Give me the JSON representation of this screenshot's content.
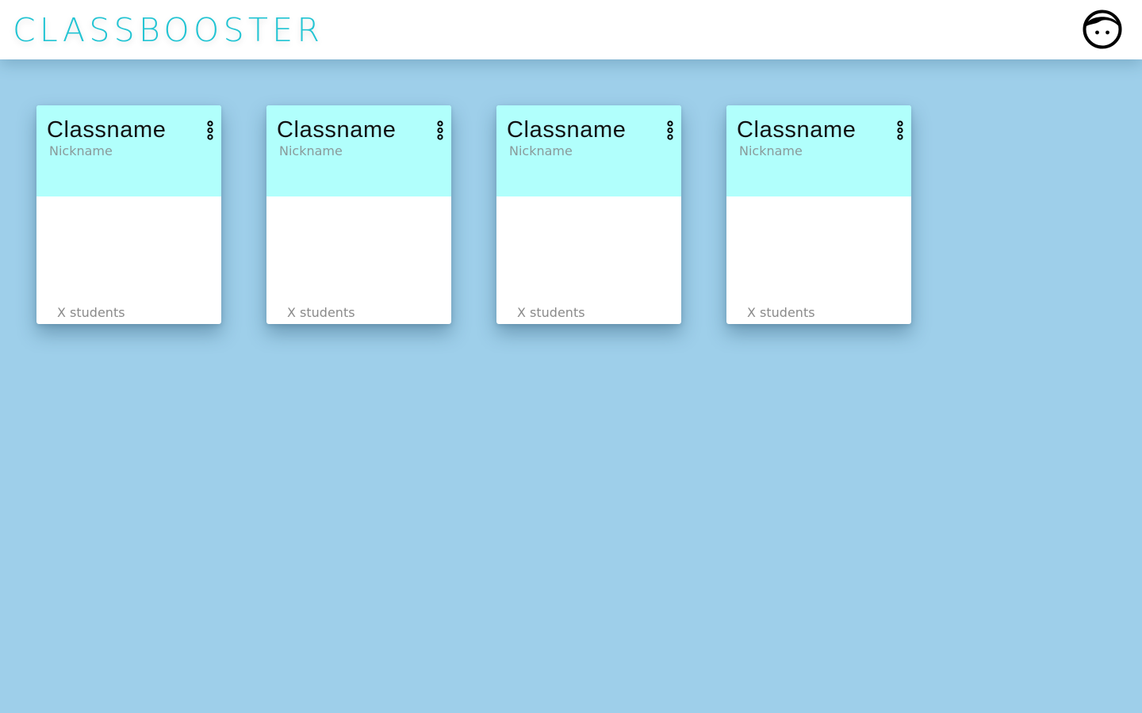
{
  "header": {
    "logo_text": "CLASSBOOSTER",
    "avatar_icon": "user-face-icon",
    "accent_color": "#21c4d3"
  },
  "page": {
    "background_color": "#9ecfea",
    "card_header_color": "#b1fffc"
  },
  "classes": [
    {
      "name": "Classname",
      "nickname": "Nickname",
      "students": "X students",
      "menu_icon": "more-vertical-icon"
    },
    {
      "name": "Classname",
      "nickname": "Nickname",
      "students": "X students",
      "menu_icon": "more-vertical-icon"
    },
    {
      "name": "Classname",
      "nickname": "Nickname",
      "students": "X students",
      "menu_icon": "more-vertical-icon"
    },
    {
      "name": "Classname",
      "nickname": "Nickname",
      "students": "X students",
      "menu_icon": "more-vertical-icon"
    }
  ]
}
